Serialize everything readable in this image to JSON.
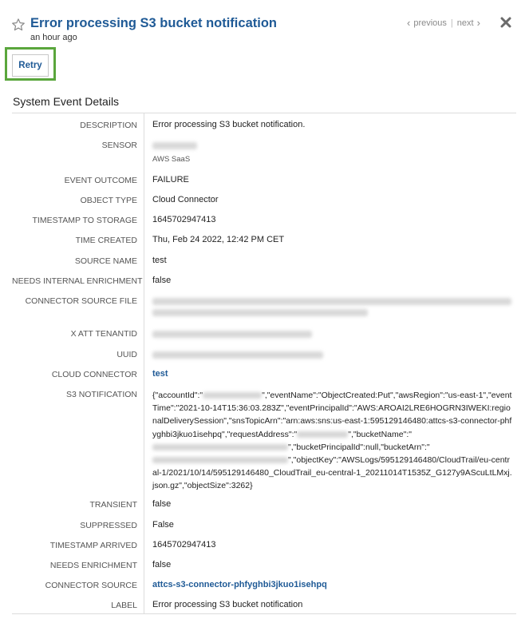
{
  "header": {
    "title": "Error processing S3 bucket notification",
    "time_ago": "an hour ago",
    "pager": {
      "previous": "previous",
      "separator": "|",
      "next": "next"
    },
    "star_icon": "star-outline-icon",
    "close_icon": "close-icon"
  },
  "actions": {
    "retry_label": "Retry"
  },
  "details": {
    "section_title": "System Event Details",
    "fields": {
      "description": {
        "label": "DESCRIPTION",
        "value": "Error processing S3 bucket notification."
      },
      "sensor": {
        "label": "SENSOR",
        "sub_value": "AWS SaaS"
      },
      "event_outcome": {
        "label": "EVENT OUTCOME",
        "value": "FAILURE"
      },
      "object_type": {
        "label": "OBJECT TYPE",
        "value": "Cloud Connector"
      },
      "timestamp_to_storage": {
        "label": "TIMESTAMP TO STORAGE",
        "value": "1645702947413"
      },
      "time_created": {
        "label": "TIME CREATED",
        "value": "Thu, Feb 24 2022, 12:42 PM CET"
      },
      "source_name": {
        "label": "SOURCE NAME",
        "value": "test"
      },
      "needs_internal_enrichment": {
        "label": "NEEDS INTERNAL ENRICHMENT",
        "value": "false"
      },
      "connector_source_file": {
        "label": "CONNECTOR SOURCE FILE"
      },
      "x_att_tenantid": {
        "label": "X ATT TENANTID"
      },
      "uuid": {
        "label": "UUID"
      },
      "cloud_connector": {
        "label": "CLOUD CONNECTOR",
        "value": "test"
      },
      "s3_notification": {
        "label": "S3 NOTIFICATION",
        "part1": "{\"accountId\":\"",
        "part2": "\",\"eventName\":\"ObjectCreated:Put\",\"awsRegion\":\"us-east-1\",\"eventTime\":\"2021-10-14T15:36:03.283Z\",\"eventPrincipalId\":\"AWS:AROAI2LRE6HOGRN3IWEKI:regionalDeliverySession\",\"snsTopicArn\":\"arn:aws:sns:us-east-1:595129146480:attcs-s3-connector-phfyghbi3jkuo1isehpq\",\"requestAddress\":\"",
        "part3": "\",\"bucketName\":\"",
        "part4": "\",\"bucketPrincipalId\":null,\"bucketArn\":\"",
        "part5": "\",\"objectKey\":\"AWSLogs/595129146480/CloudTrail/eu-central-1/2021/10/14/595129146480_CloudTrail_eu-central-1_20211014T1535Z_G127y9AScuLtLMxj.json.gz\",\"objectSize\":3262}"
      },
      "transient": {
        "label": "TRANSIENT",
        "value": "false"
      },
      "suppressed": {
        "label": "SUPPRESSED",
        "value": "False"
      },
      "timestamp_arrived": {
        "label": "TIMESTAMP ARRIVED",
        "value": "1645702947413"
      },
      "needs_enrichment": {
        "label": "NEEDS ENRICHMENT",
        "value": "false"
      },
      "connector_source": {
        "label": "CONNECTOR SOURCE",
        "value": "attcs-s3-connector-phfyghbi3jkuo1isehpq"
      },
      "label": {
        "label": "LABEL",
        "value": "Error processing S3 bucket notification"
      }
    }
  }
}
